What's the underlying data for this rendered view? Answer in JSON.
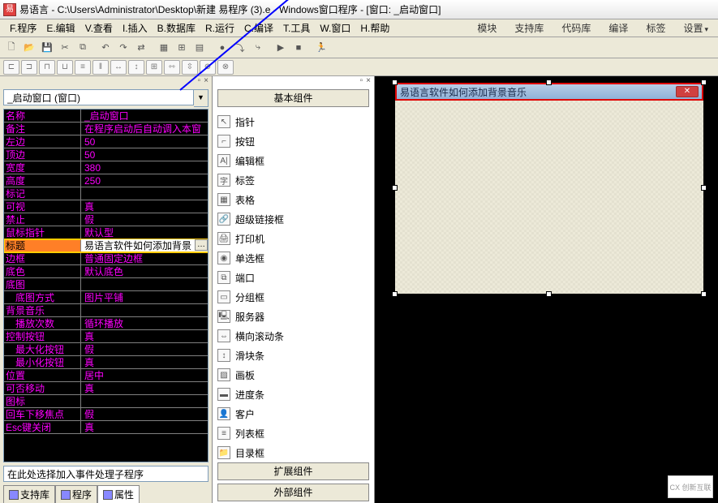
{
  "title": "易语言 - C:\\Users\\Administrator\\Desktop\\新建 易程序 (3).e - Windows窗口程序 - [窗口: _启动窗口]",
  "menus": [
    "F.程序",
    "E.编辑",
    "V.查看",
    "I.插入",
    "B.数据库",
    "R.运行",
    "C.编译",
    "T.工具",
    "W.窗口",
    "H.帮助"
  ],
  "rmenus": [
    "模块",
    "支持库",
    "代码库",
    "编译",
    "标签",
    "设置"
  ],
  "combo_value": "_启动窗口 (窗口)",
  "props": [
    {
      "n": "名称",
      "v": "_启动窗口"
    },
    {
      "n": "备注",
      "v": "在程序启动后自动调入本窗"
    },
    {
      "n": "左边",
      "v": "50"
    },
    {
      "n": "顶边",
      "v": "50"
    },
    {
      "n": "宽度",
      "v": "380"
    },
    {
      "n": "高度",
      "v": "250"
    },
    {
      "n": "标记",
      "v": ""
    },
    {
      "n": "可视",
      "v": "真"
    },
    {
      "n": "禁止",
      "v": "假"
    },
    {
      "n": "鼠标指针",
      "v": "默认型"
    },
    {
      "n": "标题",
      "v": "易语言软件如何添加背景",
      "sel": true
    },
    {
      "n": "边框",
      "v": "普通固定边框"
    },
    {
      "n": "底色",
      "v": "默认底色"
    },
    {
      "n": "底图",
      "v": ""
    },
    {
      "n": "底图方式",
      "v": "图片平铺",
      "indent": true
    },
    {
      "n": "背景音乐",
      "v": ""
    },
    {
      "n": "播放次数",
      "v": "循环播放",
      "indent": true
    },
    {
      "n": "控制按钮",
      "v": "真"
    },
    {
      "n": "最大化按钮",
      "v": "假",
      "indent": true
    },
    {
      "n": "最小化按钮",
      "v": "真",
      "indent": true
    },
    {
      "n": "位置",
      "v": "居中"
    },
    {
      "n": "可否移动",
      "v": "真"
    },
    {
      "n": "图标",
      "v": ""
    },
    {
      "n": "回车下移焦点",
      "v": "假"
    },
    {
      "n": "Esc键关闭",
      "v": "真"
    }
  ],
  "event_placeholder": "在此处选择加入事件处理子程序",
  "left_tabs": [
    "支持库",
    "程序",
    "属性"
  ],
  "mid_cats": [
    "基本组件",
    "扩展组件",
    "外部组件"
  ],
  "components": [
    {
      "ico": "↖",
      "label": "指针"
    },
    {
      "ico": "⌐",
      "label": "按钮"
    },
    {
      "ico": "A|",
      "label": "编辑框"
    },
    {
      "ico": "字",
      "label": "标签"
    },
    {
      "ico": "▦",
      "label": "表格"
    },
    {
      "ico": "🔗",
      "label": "超级链接框"
    },
    {
      "ico": "🖨",
      "label": "打印机"
    },
    {
      "ico": "◉",
      "label": "单选框"
    },
    {
      "ico": "⧉",
      "label": "端口"
    },
    {
      "ico": "▭",
      "label": "分组框"
    },
    {
      "ico": "🖳",
      "label": "服务器"
    },
    {
      "ico": "⇔",
      "label": "横向滚动条"
    },
    {
      "ico": "↕",
      "label": "滑块条"
    },
    {
      "ico": "▨",
      "label": "画板"
    },
    {
      "ico": "▬",
      "label": "进度条"
    },
    {
      "ico": "👤",
      "label": "客户"
    },
    {
      "ico": "≡",
      "label": "列表框"
    },
    {
      "ico": "📁",
      "label": "目录框"
    }
  ],
  "form_title": "易语言软件如何添加背景音乐",
  "close_glyph": "✕",
  "watermark": "CX 创新互联"
}
